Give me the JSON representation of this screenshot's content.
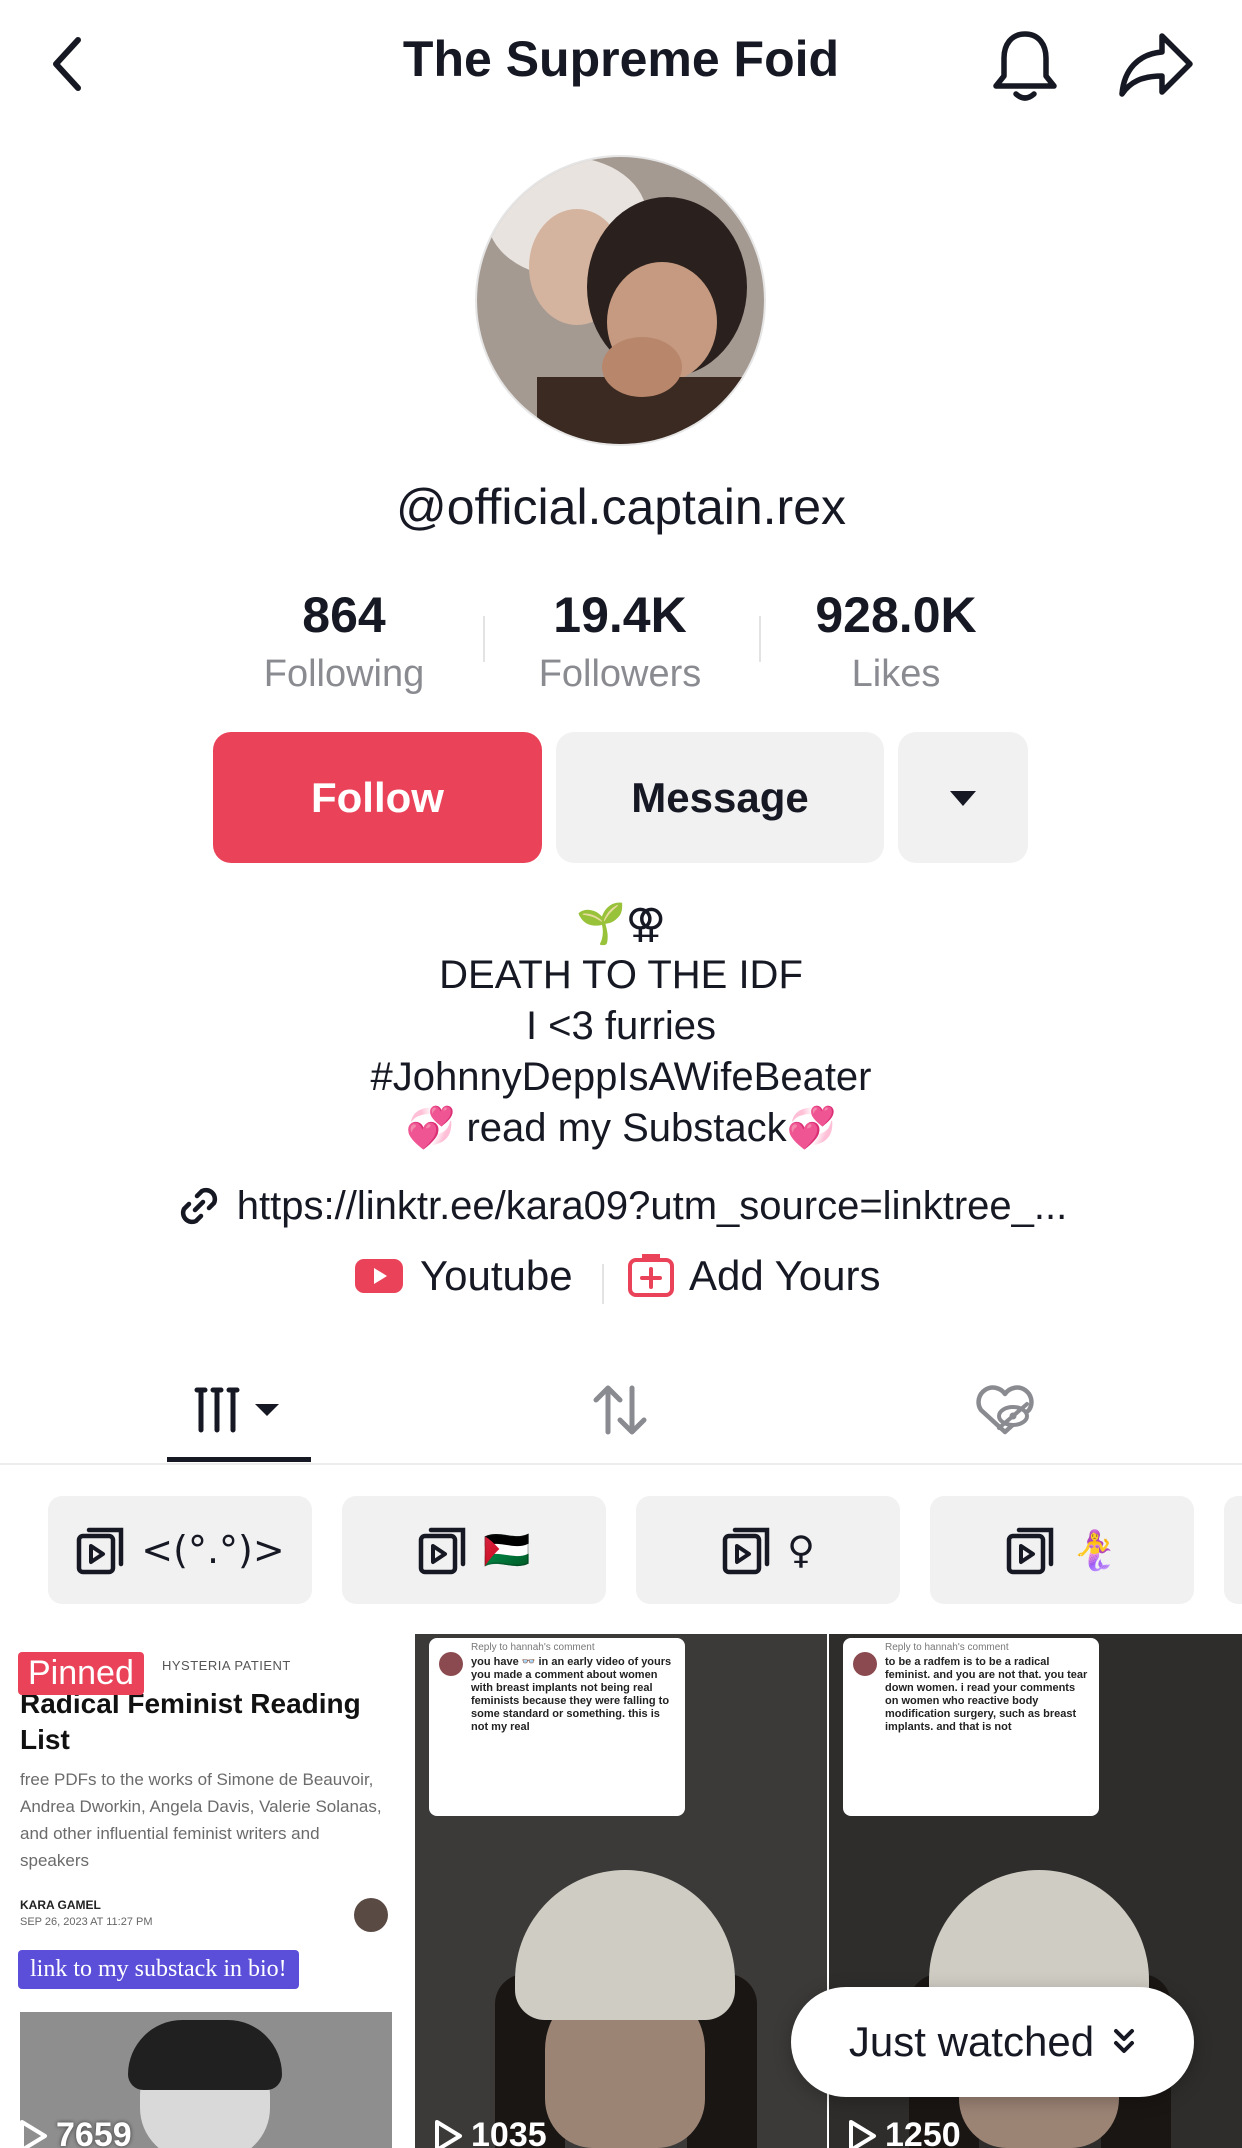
{
  "header": {
    "title": "The Supreme Foid"
  },
  "profile": {
    "handle": "@official.captain.rex",
    "stats": [
      {
        "value": "864",
        "label": "Following"
      },
      {
        "value": "19.4K",
        "label": "Followers"
      },
      {
        "value": "928.0K",
        "label": "Likes"
      }
    ],
    "follow_label": "Follow",
    "message_label": "Message",
    "bio_emoji": "🌱⚢",
    "bio_lines": [
      "DEATH TO THE IDF",
      "I <3 furries",
      "#JohnnyDeppIsAWifeBeater"
    ],
    "bio_substack": "💞 read my Substack💞",
    "link": "https://linktr.ee/kara09?utm_source=linktree_...",
    "youtube_label": "Youtube",
    "add_yours_label": "Add Yours"
  },
  "playlists": [
    {
      "label": "<(°.°)>"
    },
    {
      "label": "🇵🇸"
    },
    {
      "label": "♀"
    },
    {
      "label": "🧜‍♀️"
    }
  ],
  "videos": [
    {
      "pinned_label": "Pinned",
      "doc_tag": "HYSTERIA PATIENT",
      "doc_title": "Radical Feminist Reading List",
      "doc_desc": "free PDFs to the works of Simone de Beauvoir, Andrea Dworkin, Angela Davis, Valerie Solanas, and other influential feminist writers and speakers",
      "doc_author": "KARA GAMEL",
      "doc_date": "SEP 26, 2023 AT 11:27 PM",
      "doc_pill": "link to my substack in bio!",
      "views": "7659"
    },
    {
      "comment_head": "Reply to hannah's comment",
      "comment_text": "you have 👓 in an early video of yours you made a comment about women with breast implants not being real feminists because they were falling to some standard or something. this is not my real",
      "views": "1035"
    },
    {
      "comment_head": "Reply to hannah's comment",
      "comment_text": "to be a radfem is to be a radical feminist. and you are not that. you tear down women. i read your comments on women who reactive body modification surgery, such as breast implants. and that is not",
      "views": "1250"
    }
  ],
  "just_watched": "Just watched",
  "colors": {
    "accent": "#ea4359",
    "button_bg": "#f1f1f2",
    "text": "#161823",
    "muted": "#8a8b91"
  }
}
